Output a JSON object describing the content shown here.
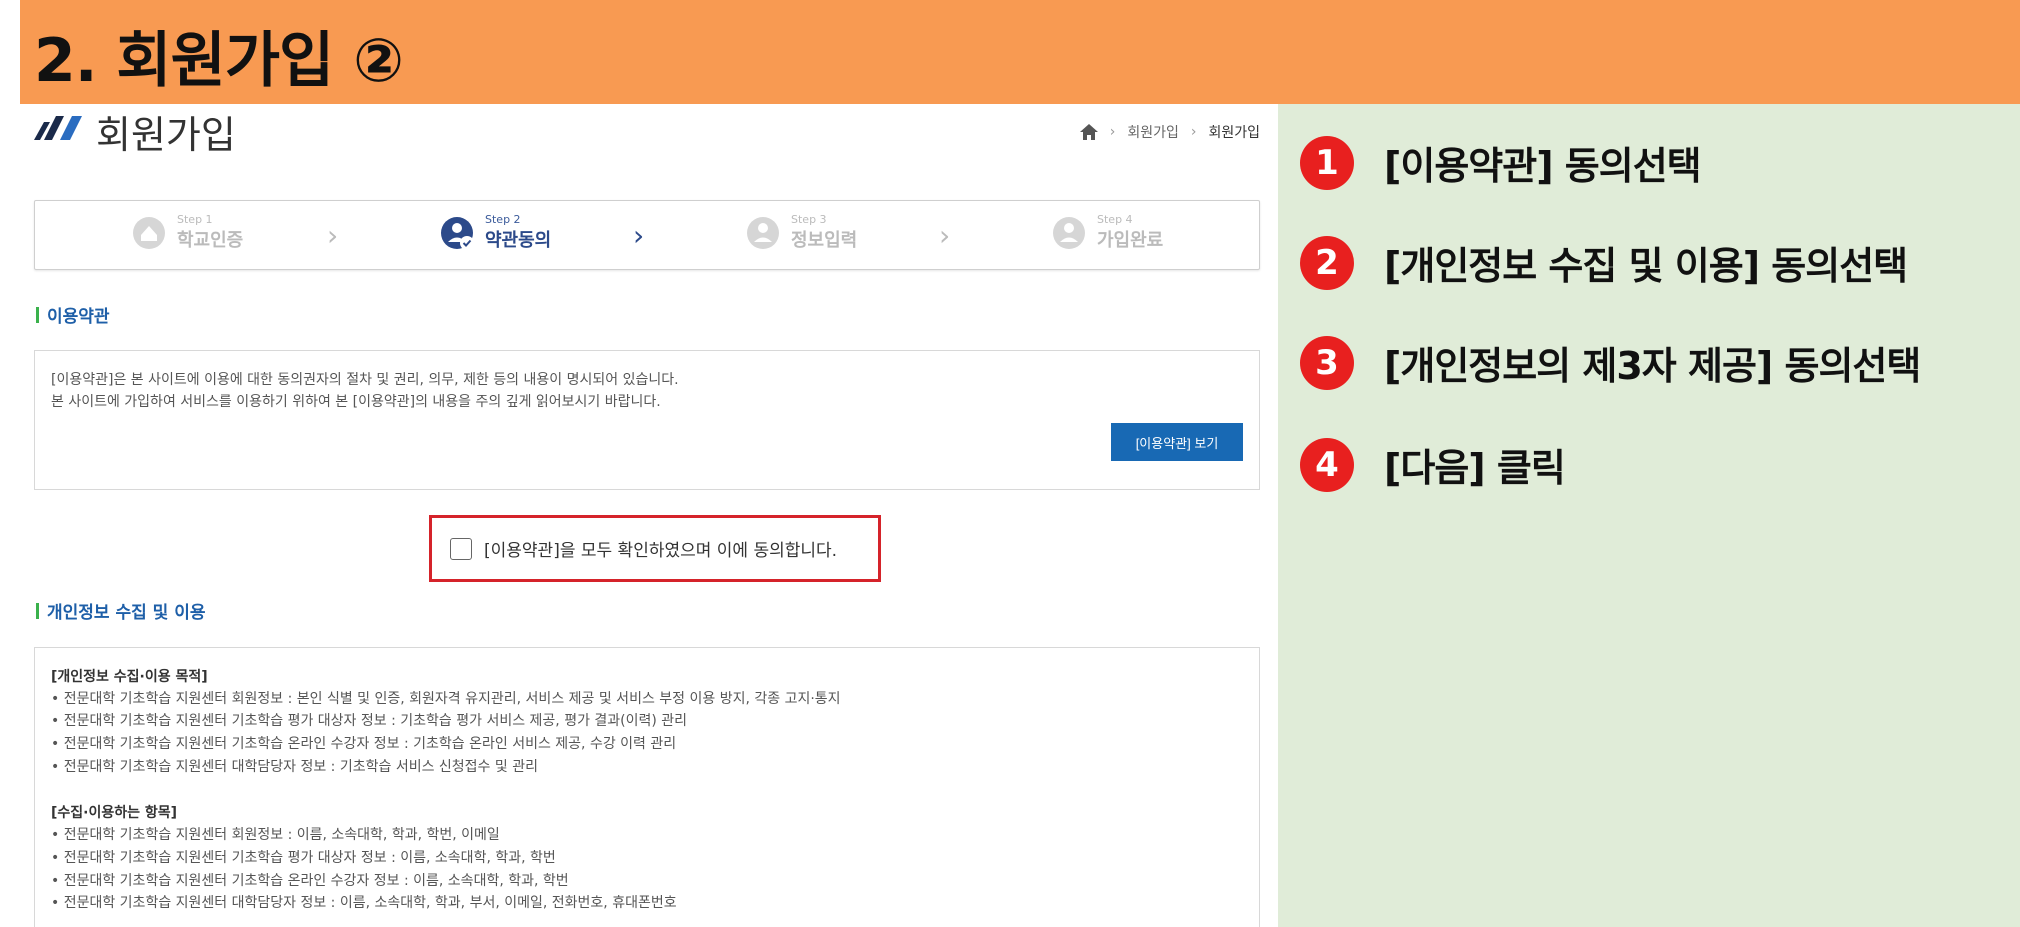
{
  "banner": {
    "title": "2. 회원가입 ②"
  },
  "instructions": [
    {
      "num": "1",
      "text": "[이용약관] 동의선택"
    },
    {
      "num": "2",
      "text": "[개인정보 수집 및 이용] 동의선택"
    },
    {
      "num": "3",
      "text": "[개인정보의 제3자 제공] 동의선택"
    },
    {
      "num": "4",
      "text": "[다음] 클릭"
    }
  ],
  "page": {
    "heading": "회원가입",
    "breadcrumb": [
      "회원가입",
      "회원가입"
    ]
  },
  "stepper": [
    {
      "sub": "Step 1",
      "label": "학교인증"
    },
    {
      "sub": "Step 2",
      "label": "약관동의"
    },
    {
      "sub": "Step 3",
      "label": "정보입력"
    },
    {
      "sub": "Step 4",
      "label": "가입완료"
    }
  ],
  "terms": {
    "title": "이용약관",
    "line1": "[이용약관]은 본 사이트에 이용에 대한 동의권자의 절차 및 권리, 의무, 제한 등의 내용이 명시되어 있습니다.",
    "line2": "본 사이트에 가입하여 서비스를 이용하기 위하여 본 [이용약관]의 내용을 주의 깊게 읽어보시기 바랍니다.",
    "button": "[이용약관] 보기",
    "agree": "[이용약관]을 모두 확인하였으며 이에 동의합니다."
  },
  "privacy": {
    "title": "개인정보 수집 및 이용",
    "purpose_head": "[개인정보 수집·이용 목적]",
    "purpose": [
      "• 전문대학 기초학습 지원센터 회원정보 : 본인 식별 및 인증, 회원자격 유지관리, 서비스 제공 및 서비스 부정 이용 방지, 각종 고지·통지",
      "• 전문대학 기초학습 지원센터 기초학습 평가 대상자 정보 : 기초학습 평가 서비스 제공, 평가 결과(이력) 관리",
      "• 전문대학 기초학습 지원센터 기초학습 온라인 수강자 정보 : 기초학습 온라인 서비스 제공, 수강 이력 관리",
      "• 전문대학 기초학습 지원센터 대학담당자 정보 : 기초학습 서비스 신청접수 및 관리"
    ],
    "items_head": "[수집·이용하는 항목]",
    "items": [
      "• 전문대학 기초학습 지원센터 회원정보 : 이름, 소속대학, 학과, 학번, 이메일",
      "• 전문대학 기초학습 지원센터 기초학습 평가 대상자 정보 : 이름, 소속대학, 학과, 학번",
      "• 전문대학 기초학습 지원센터 기초학습 온라인 수강자 정보 : 이름, 소속대학, 학과, 학번",
      "• 전문대학 기초학습 지원센터 대학담당자 정보 : 이름, 소속대학, 학과, 부서, 이메일, 전화번호, 휴대폰번호"
    ]
  }
}
